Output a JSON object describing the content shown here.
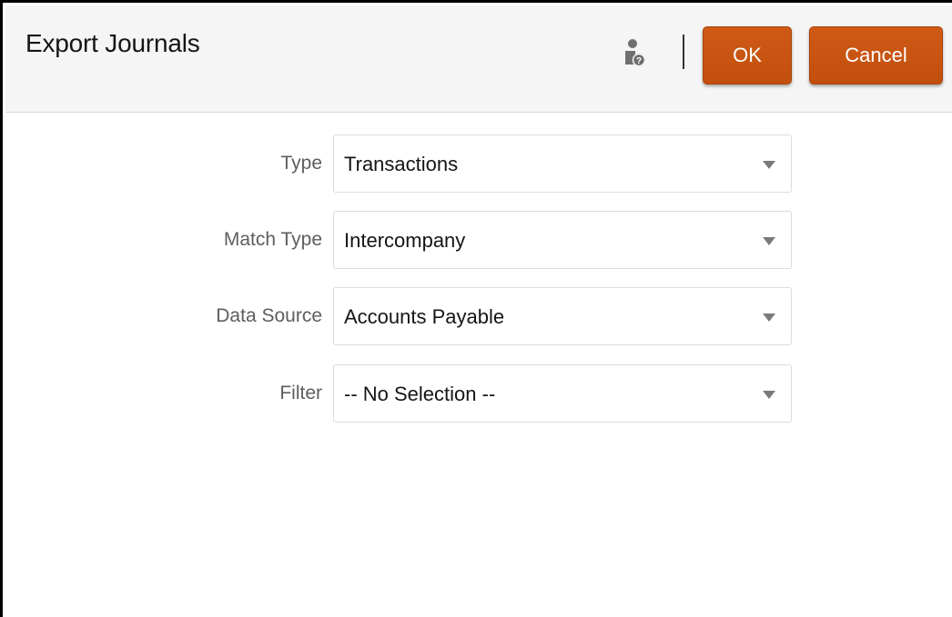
{
  "dialog": {
    "title": "Export Journals",
    "ok_label": "OK",
    "cancel_label": "Cancel",
    "help_icon": "user-help-icon",
    "accent_color": "#c95312"
  },
  "form": {
    "fields": [
      {
        "label": "Type",
        "value": "Transactions"
      },
      {
        "label": "Match Type",
        "value": "Intercompany"
      },
      {
        "label": "Data Source",
        "value": "Accounts Payable"
      },
      {
        "label": "Filter",
        "value": "-- No Selection --"
      }
    ]
  }
}
